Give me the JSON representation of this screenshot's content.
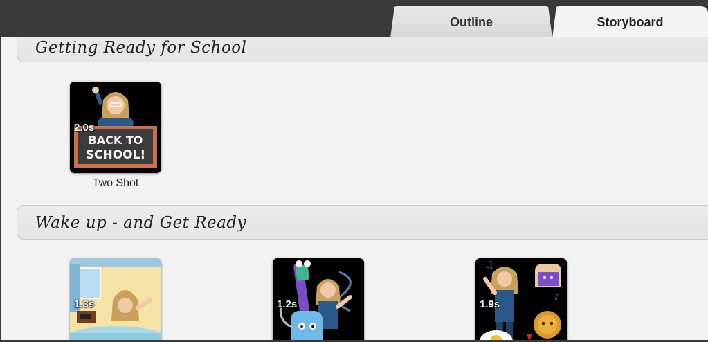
{
  "tabs": [
    {
      "label": "Outline",
      "active": false
    },
    {
      "label": "Storyboard",
      "active": true
    }
  ],
  "sections": [
    {
      "title": "Getting Ready for School",
      "shots": [
        {
          "duration": "2.0s",
          "label": "Two Shot",
          "chalkboard_text": [
            "BACK TO",
            "SCHOOL!"
          ]
        }
      ]
    },
    {
      "title": "Wake up - and Get Ready",
      "shots": [
        {
          "duration": "1.3s"
        },
        {
          "duration": "1.2s"
        },
        {
          "duration": "1.9s"
        }
      ]
    }
  ],
  "colors": {
    "chrome": "#3a3a3a",
    "content_bg": "#f2f2f2",
    "tab_active": "#f4f4f4",
    "tab_inactive": "#dcdcdc"
  }
}
